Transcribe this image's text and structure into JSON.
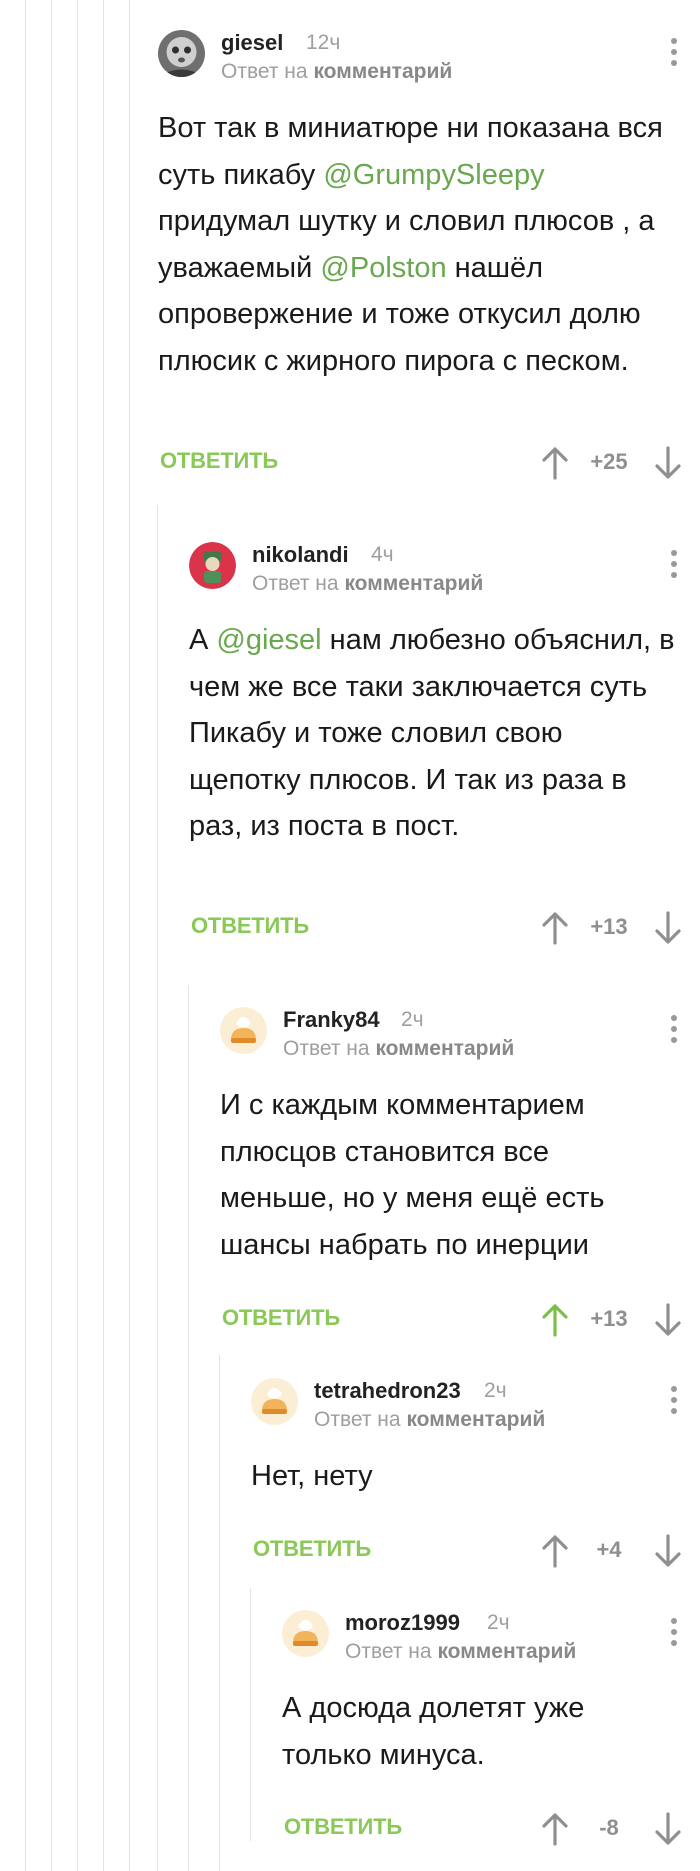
{
  "reply_on_label": "Ответ на",
  "reply_target_label": "комментарий",
  "reply_button_label": "ОТВЕТИТЬ",
  "colors": {
    "accent": "#8ac858",
    "mention": "#6aa84f",
    "upvoted": "#7bbf4a",
    "muted": "#9e9e9e"
  },
  "comments": [
    {
      "author": "giesel",
      "time": "12ч",
      "score": "+25",
      "text_parts": [
        "Вот так в миниатюре ни показана вся суть пикабу ",
        "@GrumpySleepy",
        " придумал шутку и словил плюсов , а уважаемый ",
        "@Polston",
        " нашёл опровержение и тоже откусил долю плюсик с жирного пирога с песком."
      ],
      "avatar_icon": "face-photo-avatar"
    },
    {
      "author": "nikolandi",
      "time": "4ч",
      "score": "+13",
      "text_parts": [
        "А ",
        "@giesel",
        " нам любезно объяснил, в чем же все таки заключается суть Пикабу и тоже словил свою щепотку плюсов. И так из раза в раз, из поста в пост."
      ],
      "avatar_icon": "character-avatar"
    },
    {
      "author": "Franky84",
      "time": "2ч",
      "score": "+13",
      "text_parts": [
        "И с каждым комментарием плюсцов становится все меньше, но у меня ещё есть шансы набрать по инерции"
      ],
      "avatar_icon": "default-pie-avatar",
      "upvoted": true
    },
    {
      "author": "tetrahedron23",
      "time": "2ч",
      "score": "+4",
      "text_parts": [
        "Нет, нету"
      ],
      "avatar_icon": "default-pie-avatar"
    },
    {
      "author": "moroz1999",
      "time": "2ч",
      "score": "-8",
      "text_parts": [
        "А досюда долетят уже только минуса."
      ],
      "avatar_icon": "default-pie-avatar"
    }
  ]
}
